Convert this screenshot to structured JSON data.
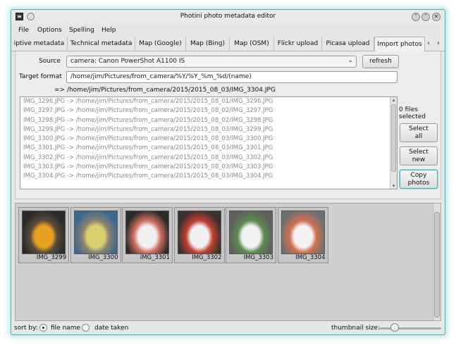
{
  "window": {
    "title": "Photini photo metadata editor",
    "buttons": [
      "˅",
      "˄",
      "✕"
    ]
  },
  "menu": [
    "File",
    "Options",
    "Spelling",
    "Help"
  ],
  "tabs": [
    {
      "label": "iptive metadata",
      "active": false
    },
    {
      "label": "Technical metadata",
      "active": false
    },
    {
      "label": "Map (Google)",
      "active": false
    },
    {
      "label": "Map (Bing)",
      "active": false
    },
    {
      "label": "Map (OSM)",
      "active": false
    },
    {
      "label": "Flickr upload",
      "active": false
    },
    {
      "label": "Picasa upload",
      "active": false
    },
    {
      "label": "Import photos",
      "active": true
    }
  ],
  "tab_arrows": {
    "left": "‹",
    "right": "›"
  },
  "import": {
    "source_label": "Source",
    "source_value": "camera: Canon PowerShot A1100 IS",
    "source_arrow": "⌄",
    "refresh_label": "refresh",
    "target_label": "Target format",
    "target_value": "/home/jim/Pictures/from_camera/%Y/%Y_%m_%d/(name)",
    "preview": "=> /home/jim/Pictures/from_camera/2015/2015_08_03/IMG_3304.JPG",
    "files": [
      "IMG_3296.JPG -> /home/jim/Pictures/from_camera/2015/2015_08_01/IMG_3296.JPG",
      "IMG_3297.JPG -> /home/jim/Pictures/from_camera/2015/2015_08_02/IMG_3297.JPG",
      "IMG_3298.JPG -> /home/jim/Pictures/from_camera/2015/2015_08_02/IMG_3298.JPG",
      "IMG_3299.JPG -> /home/jim/Pictures/from_camera/2015/2015_08_03/IMG_3299.JPG",
      "IMG_3300.JPG -> /home/jim/Pictures/from_camera/2015/2015_08_03/IMG_3300.JPG",
      "IMG_3301.JPG -> /home/jim/Pictures/from_camera/2015/2015_08_03/IMG_3301.JPG",
      "IMG_3302.JPG -> /home/jim/Pictures/from_camera/2015/2015_08_03/IMG_3302.JPG",
      "IMG_3303.JPG -> /home/jim/Pictures/from_camera/2015/2015_08_03/IMG_3303.JPG",
      "IMG_3304.JPG -> /home/jim/Pictures/from_camera/2015/2015_08_03/IMG_3304.JPG"
    ],
    "files_selected_line1": "0 files",
    "files_selected_line2": "selected",
    "select_all_line1": "Select",
    "select_all_line2": "all",
    "select_new_line1": "Select",
    "select_new_line2": "new",
    "copy_line1": "Copy",
    "copy_line2": "photos"
  },
  "thumbnails": [
    {
      "label": "IMG_3299",
      "colors": [
        "#2a2a2a",
        "#e8a020",
        "#5a4a3a"
      ]
    },
    {
      "label": "IMG_3300",
      "colors": [
        "#3a6a90",
        "#d9d070",
        "#8a8070"
      ]
    },
    {
      "label": "IMG_3301",
      "colors": [
        "#2a2a2a",
        "#f0f0f0",
        "#d07060"
      ]
    },
    {
      "label": "IMG_3302",
      "colors": [
        "#3a3030",
        "#f0f0f0",
        "#c04030"
      ]
    },
    {
      "label": "IMG_3303",
      "colors": [
        "#606060",
        "#f2f2f2",
        "#5a8a4a"
      ]
    },
    {
      "label": "IMG_3304",
      "colors": [
        "#707070",
        "#f2f2f2",
        "#d07050"
      ]
    }
  ],
  "status": {
    "sort_label": "sort by:",
    "file_name_label": "file name",
    "date_taken_label": "date taken",
    "thumb_size_label": "thumbnail size:",
    "thumb_size_value": 0.25
  }
}
